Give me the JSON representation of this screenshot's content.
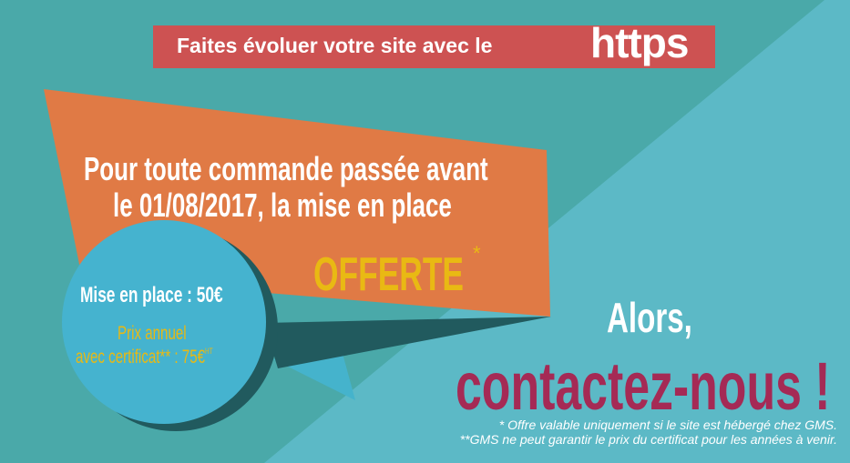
{
  "banner": {
    "text": "Faites évoluer votre site avec le",
    "https": "https"
  },
  "promo": {
    "line1": "Pour toute commande passée avant",
    "line2": "le 01/08/2017, la mise en place",
    "offer": "OFFERTE",
    "offer_mark": "*"
  },
  "circle": {
    "setup": "Mise en place : 50€",
    "annual_line1": "Prix annuel",
    "annual_line2": "avec certificat** : 75€",
    "tax": "HT"
  },
  "cta": {
    "line1": "Alors,",
    "line2": "contactez-nous !"
  },
  "notes": [
    "* Offre valable uniquement si le site est hébergé chez GMS.",
    "**GMS ne peut garantir le prix du certificat pour les années à venir."
  ],
  "colors": {
    "teal": "#4aa9a9",
    "light": "#5cb9c6",
    "orange": "#e07a45",
    "red": "#cd5252",
    "yellow": "#e9b913",
    "magenta": "#a52a55"
  }
}
